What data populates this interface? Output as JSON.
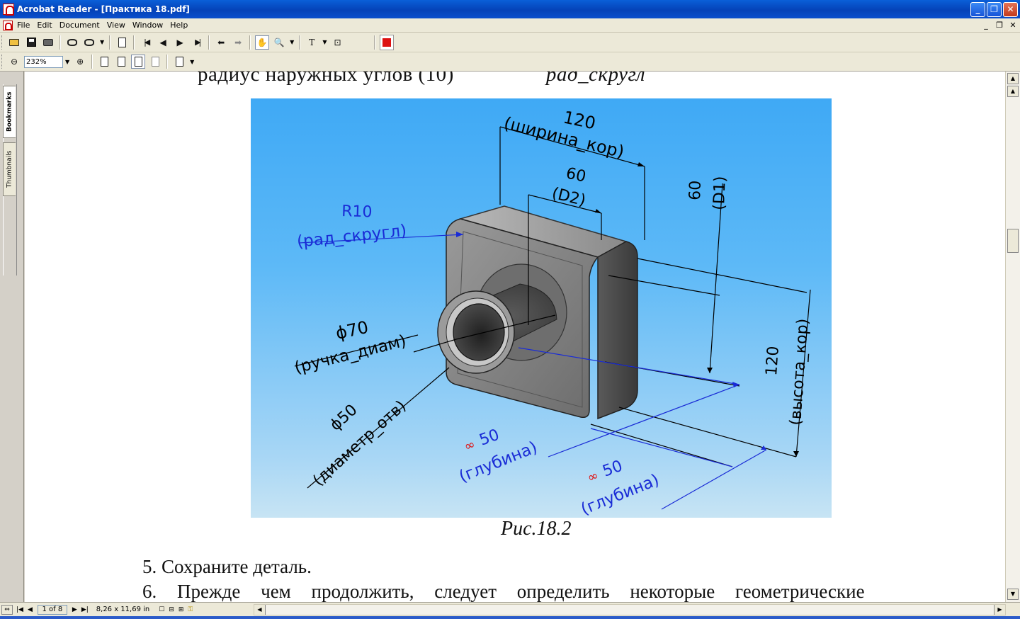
{
  "window": {
    "title": "Acrobat Reader - [Практика 18.pdf]",
    "minimize": "_",
    "maximize": "❐",
    "close": "✕"
  },
  "menu": {
    "items": [
      "File",
      "Edit",
      "Document",
      "View",
      "Window",
      "Help"
    ],
    "mdi_minimize": "_",
    "mdi_restore": "❐",
    "mdi_close": "✕"
  },
  "toolbar": {
    "zoom_value": "232%",
    "zoom_out": "⊖",
    "zoom_in": "⊕"
  },
  "nav_panel": {
    "tab_bookmarks": "Bookmarks",
    "tab_thumbnails": "Thumbnails"
  },
  "document": {
    "cut_line_left": "радиус наружных углов (10)",
    "cut_line_right": "рад_скругл",
    "figure_caption": "Рис.18.2",
    "step5": "5.  Сохраните деталь.",
    "step6": "6.  Прежде чем продолжить, следует определить некоторые геометрические",
    "figure_labels": {
      "width_value": "120",
      "width_name": "(ширина_кор)",
      "d2_value": "60",
      "d2_name": "(D2)",
      "d1_value": "60",
      "d1_name": "(D1)",
      "radius_value": "R10",
      "radius_name": "(рад_скругл)",
      "handle_value": "ϕ70",
      "handle_name": "(ручка_диам)",
      "hole_value": "ϕ50",
      "hole_name": "(диаметр_отв)",
      "depth1_value": "50",
      "depth1_name": "(глубина)",
      "depth2_value": "50",
      "depth2_name": "(глубина)",
      "height_value": "120",
      "height_name": "(высота_кор)"
    }
  },
  "status": {
    "page_of": "1 of 8",
    "page_size": "8,26 x 11,69 in"
  },
  "colors": {
    "title_bar": "#0542b8",
    "figure_top": "#3fa9f5",
    "blue_dim": "#1a2cd6",
    "black_dim": "#000000",
    "link_red": "#e01010"
  }
}
